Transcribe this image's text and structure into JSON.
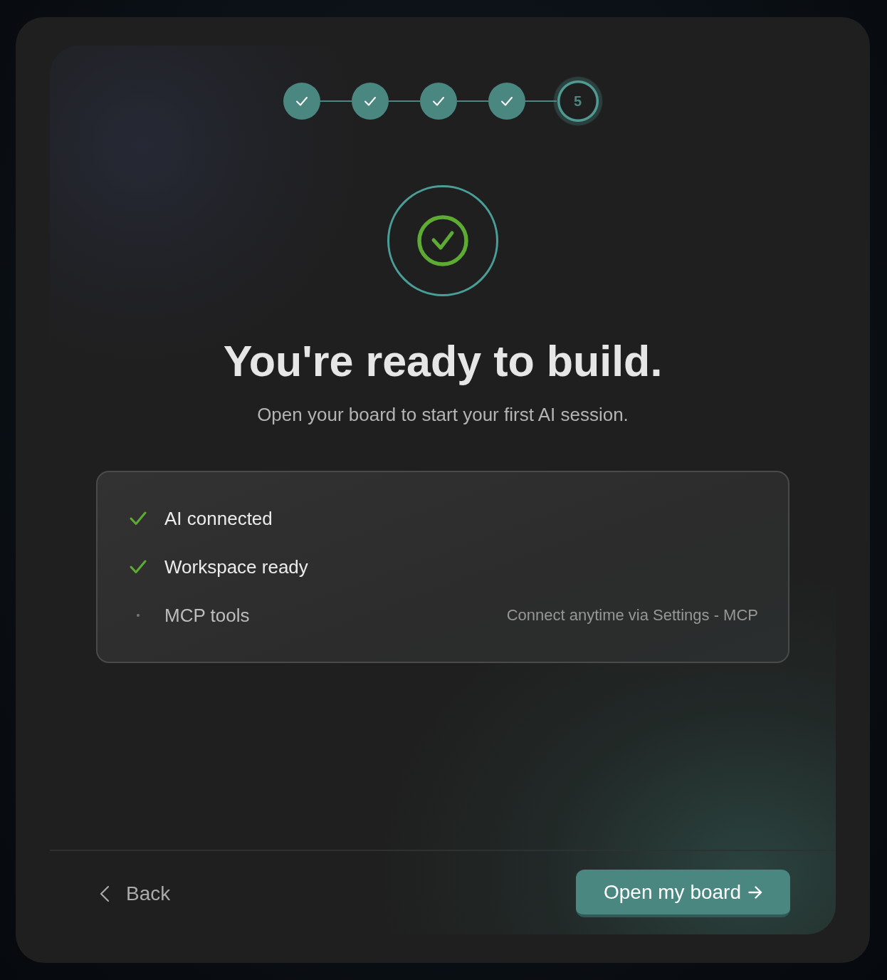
{
  "stepper": {
    "steps": [
      {
        "done": true
      },
      {
        "done": true
      },
      {
        "done": true
      },
      {
        "done": true
      },
      {
        "done": false,
        "label": "5"
      }
    ]
  },
  "hero": {
    "title": "You're ready to build.",
    "subtitle": "Open your board to start your first AI session."
  },
  "checklist": {
    "items": [
      {
        "label": "AI connected",
        "done": true
      },
      {
        "label": "Workspace ready",
        "done": true
      },
      {
        "label": "MCP tools",
        "done": false,
        "note": "Connect anytime via Settings - MCP"
      }
    ]
  },
  "footer": {
    "back_button": {
      "label": "Back"
    },
    "primary_button": {
      "label": "Open my board"
    }
  }
}
